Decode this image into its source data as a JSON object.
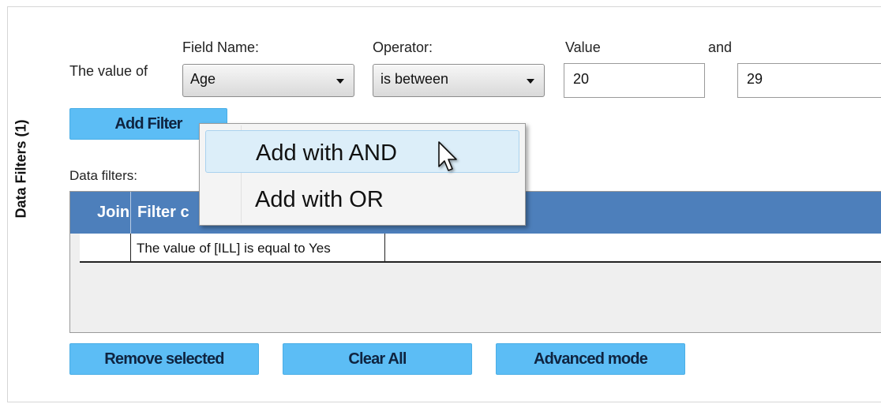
{
  "panel": {
    "side_label": "Data Filters (1)"
  },
  "filter_row": {
    "prefix": "The value of",
    "field_label": "Field Name:",
    "field_value": "Age",
    "operator_label": "Operator:",
    "operator_value": "is between",
    "value_label": "Value",
    "and_label": "and",
    "value_from": "20",
    "value_to": "29"
  },
  "buttons": {
    "add_filter": "Add Filter",
    "remove_selected": "Remove selected",
    "clear_all": "Clear All",
    "advanced_mode": "Advanced mode"
  },
  "popup_menu": {
    "items": [
      "Add with AND",
      "Add with OR"
    ],
    "highlighted": "Add with AND"
  },
  "data_filters": {
    "label": "Data filters:",
    "columns": [
      "Join",
      "Filter c"
    ],
    "rows": [
      {
        "join": "",
        "filter": "The value of [ILL] is equal to Yes"
      }
    ]
  },
  "icons": {
    "cursor": "pointer-cursor-icon",
    "dropdown": "chevron-down-icon"
  },
  "colors": {
    "button_bg": "#5cbdf5",
    "grid_header_bg": "#4d7fbb",
    "menu_highlight": "#dceef9"
  }
}
